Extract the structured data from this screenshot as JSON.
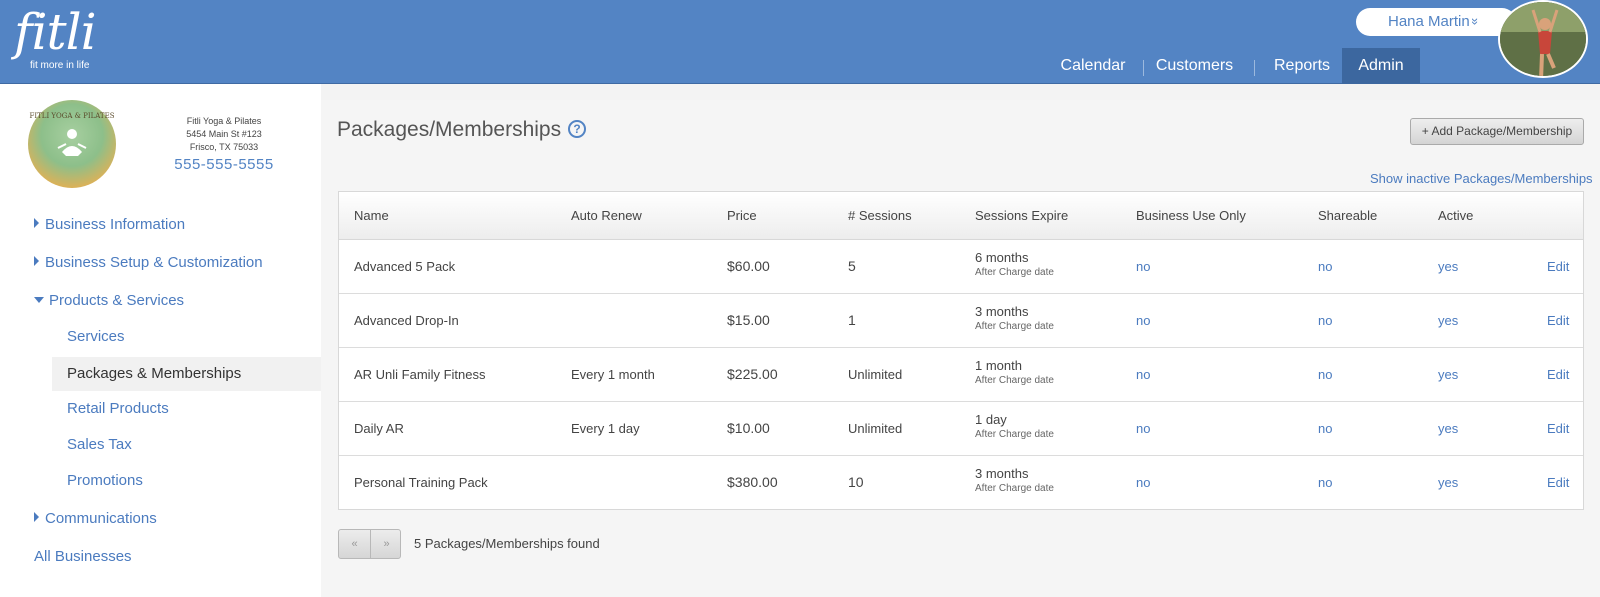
{
  "header": {
    "logo_text": "fitli",
    "logo_tagline": "fit more in life",
    "user_name": "Hana Martin",
    "user_chevron": "»",
    "nav": [
      {
        "label": "Calendar"
      },
      {
        "label": "Customers"
      },
      {
        "label": "Reports"
      },
      {
        "label": "Admin",
        "active": true
      }
    ],
    "brand_color": "#5384c4"
  },
  "business": {
    "name": "Fitli Yoga & Pilates",
    "address1": "5454 Main St #123",
    "address2": "Frisco, TX 75033",
    "phone": "555-555-5555",
    "logo_text": "FITLI YOGA & PILATES"
  },
  "sidebar": {
    "items": [
      {
        "label": "Business Information",
        "expanded": false
      },
      {
        "label": "Business Setup & Customization",
        "expanded": false
      },
      {
        "label": "Products & Services",
        "expanded": true
      },
      {
        "label": "Communications",
        "expanded": false
      },
      {
        "label": "All Businesses"
      }
    ],
    "sub_items": [
      {
        "label": "Services"
      },
      {
        "label": "Packages & Memberships",
        "active": true
      },
      {
        "label": "Retail Products"
      },
      {
        "label": "Sales Tax"
      },
      {
        "label": "Promotions"
      }
    ]
  },
  "main": {
    "title": "Packages/Memberships",
    "help_icon": "?",
    "add_button": "+ Add Package/Membership",
    "show_inactive": "Show inactive Packages/Memberships",
    "columns": [
      "Name",
      "Auto Renew",
      "Price",
      "# Sessions",
      "Sessions Expire",
      "Business Use Only",
      "Shareable",
      "Active"
    ],
    "rows": [
      {
        "name": "Advanced 5 Pack",
        "auto_renew": "",
        "price": "$60.00",
        "sessions": "5",
        "expire": "6 months",
        "expire_sub": "After Charge date",
        "business_use_only": "no",
        "shareable": "no",
        "active": "yes",
        "edit": "Edit"
      },
      {
        "name": "Advanced Drop-In",
        "auto_renew": "",
        "price": "$15.00",
        "sessions": "1",
        "expire": "3 months",
        "expire_sub": "After Charge date",
        "business_use_only": "no",
        "shareable": "no",
        "active": "yes",
        "edit": "Edit"
      },
      {
        "name": "AR Unli Family Fitness",
        "auto_renew": "Every 1 month",
        "price": "$225.00",
        "sessions": "Unlimited",
        "expire": "1 month",
        "expire_sub": "After Charge date",
        "business_use_only": "no",
        "shareable": "no",
        "active": "yes",
        "edit": "Edit"
      },
      {
        "name": "Daily AR",
        "auto_renew": "Every 1 day",
        "price": "$10.00",
        "sessions": "Unlimited",
        "expire": "1 day",
        "expire_sub": "After Charge date",
        "business_use_only": "no",
        "shareable": "no",
        "active": "yes",
        "edit": "Edit"
      },
      {
        "name": "Personal Training Pack",
        "auto_renew": "",
        "price": "$380.00",
        "sessions": "10",
        "expire": "3 months",
        "expire_sub": "After Charge date",
        "business_use_only": "no",
        "shareable": "no",
        "active": "yes",
        "edit": "Edit"
      }
    ],
    "pager_prev": "«",
    "pager_next": "»",
    "found_text": "5 Packages/Memberships found"
  }
}
